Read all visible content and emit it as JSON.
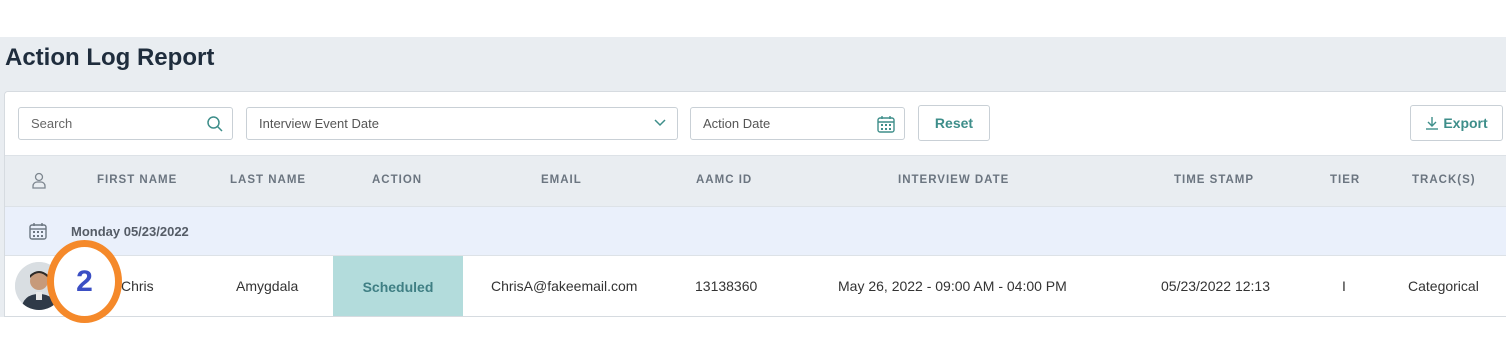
{
  "page": {
    "title": "Action Log Report"
  },
  "filters": {
    "search_placeholder": "Search",
    "interview_event_date_placeholder": "Interview Event Date",
    "action_date_placeholder": "Action Date",
    "reset_label": "Reset",
    "export_label": "Export"
  },
  "table": {
    "headers": {
      "first_name": "FIRST NAME",
      "last_name": "LAST NAME",
      "action": "ACTION",
      "email": "EMAIL",
      "aamc_id": "AAMC ID",
      "interview_date": "INTERVIEW DATE",
      "time_stamp": "TIME STAMP",
      "tier": "TIER",
      "tracks": "TRACK(S)"
    },
    "group": {
      "label": "Monday 05/23/2022"
    },
    "rows": [
      {
        "first_name": "Chris",
        "last_name": "Amygdala",
        "action": "Scheduled",
        "email": "ChrisA@fakeemail.com",
        "aamc_id": "13138360",
        "interview_date": "May 26, 2022 - 09:00 AM - 04:00 PM",
        "time_stamp": "05/23/2022 12:13",
        "tier": "I",
        "tracks": "Categorical"
      }
    ]
  },
  "annotation": {
    "step_number": "2",
    "color": "#f5892a"
  },
  "colors": {
    "accent": "#3e8e8a",
    "status_bg": "#b3dcdc",
    "header_bg": "#e9edf1",
    "group_bg": "#eaf0fb"
  }
}
